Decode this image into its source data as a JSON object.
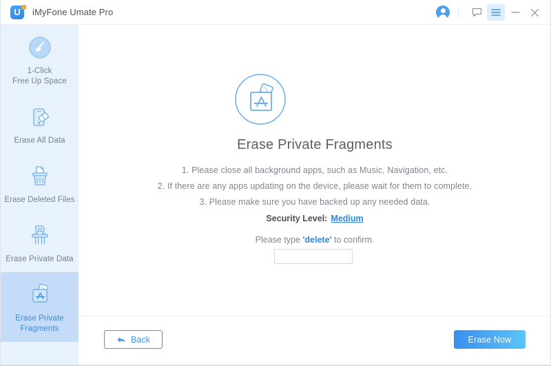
{
  "window": {
    "title": "iMyFone Umate Pro",
    "logo_letter": "U",
    "controls": {
      "avatar": "account-avatar",
      "feedback": "feedback-icon",
      "menu": "hamburger-menu-icon",
      "minimize": "minimize-icon",
      "close": "close-icon"
    }
  },
  "sidebar": {
    "items": [
      {
        "label_line1": "1-Click",
        "label_line2": "Free Up Space",
        "icon": "broom-circle-icon",
        "selected": false
      },
      {
        "label_line1": "Erase All Data",
        "label_line2": "",
        "icon": "phone-eraser-icon",
        "selected": false
      },
      {
        "label_line1": "Erase Deleted Files",
        "label_line2": "",
        "icon": "shredder-trash-icon",
        "selected": false
      },
      {
        "label_line1": "Erase Private Data",
        "label_line2": "",
        "icon": "shredder-lock-icon",
        "selected": false
      },
      {
        "label_line1": "Erase Private",
        "label_line2": "Fragments",
        "icon": "appstore-folder-icon",
        "selected": true
      }
    ]
  },
  "main": {
    "hero_icon": "appstore-fragments-circle-icon",
    "heading": "Erase Private Fragments",
    "instructions": [
      "1. Please close all background apps, such as Music, Navigation, etc.",
      "2. If there are any apps updating on the device, please wait for them to complete.",
      "3. Please make sure you have backed up any needed data."
    ],
    "security": {
      "label": "Security Level:",
      "value": "Medium"
    },
    "confirm": {
      "prefix": "Please type",
      "word": "'delete'",
      "suffix": "to confirm.",
      "input_value": "",
      "input_placeholder": ""
    }
  },
  "footer": {
    "back_label": "Back",
    "erase_label": "Erase Now"
  },
  "colors": {
    "accent": "#3d93ec",
    "sidebar_bg": "#e8f2fd",
    "sidebar_selected_bg": "#c4dcf8",
    "button_gradient_start": "#3a8eef",
    "button_gradient_end": "#5ac5f8",
    "logo_orange": "#f7a531"
  }
}
